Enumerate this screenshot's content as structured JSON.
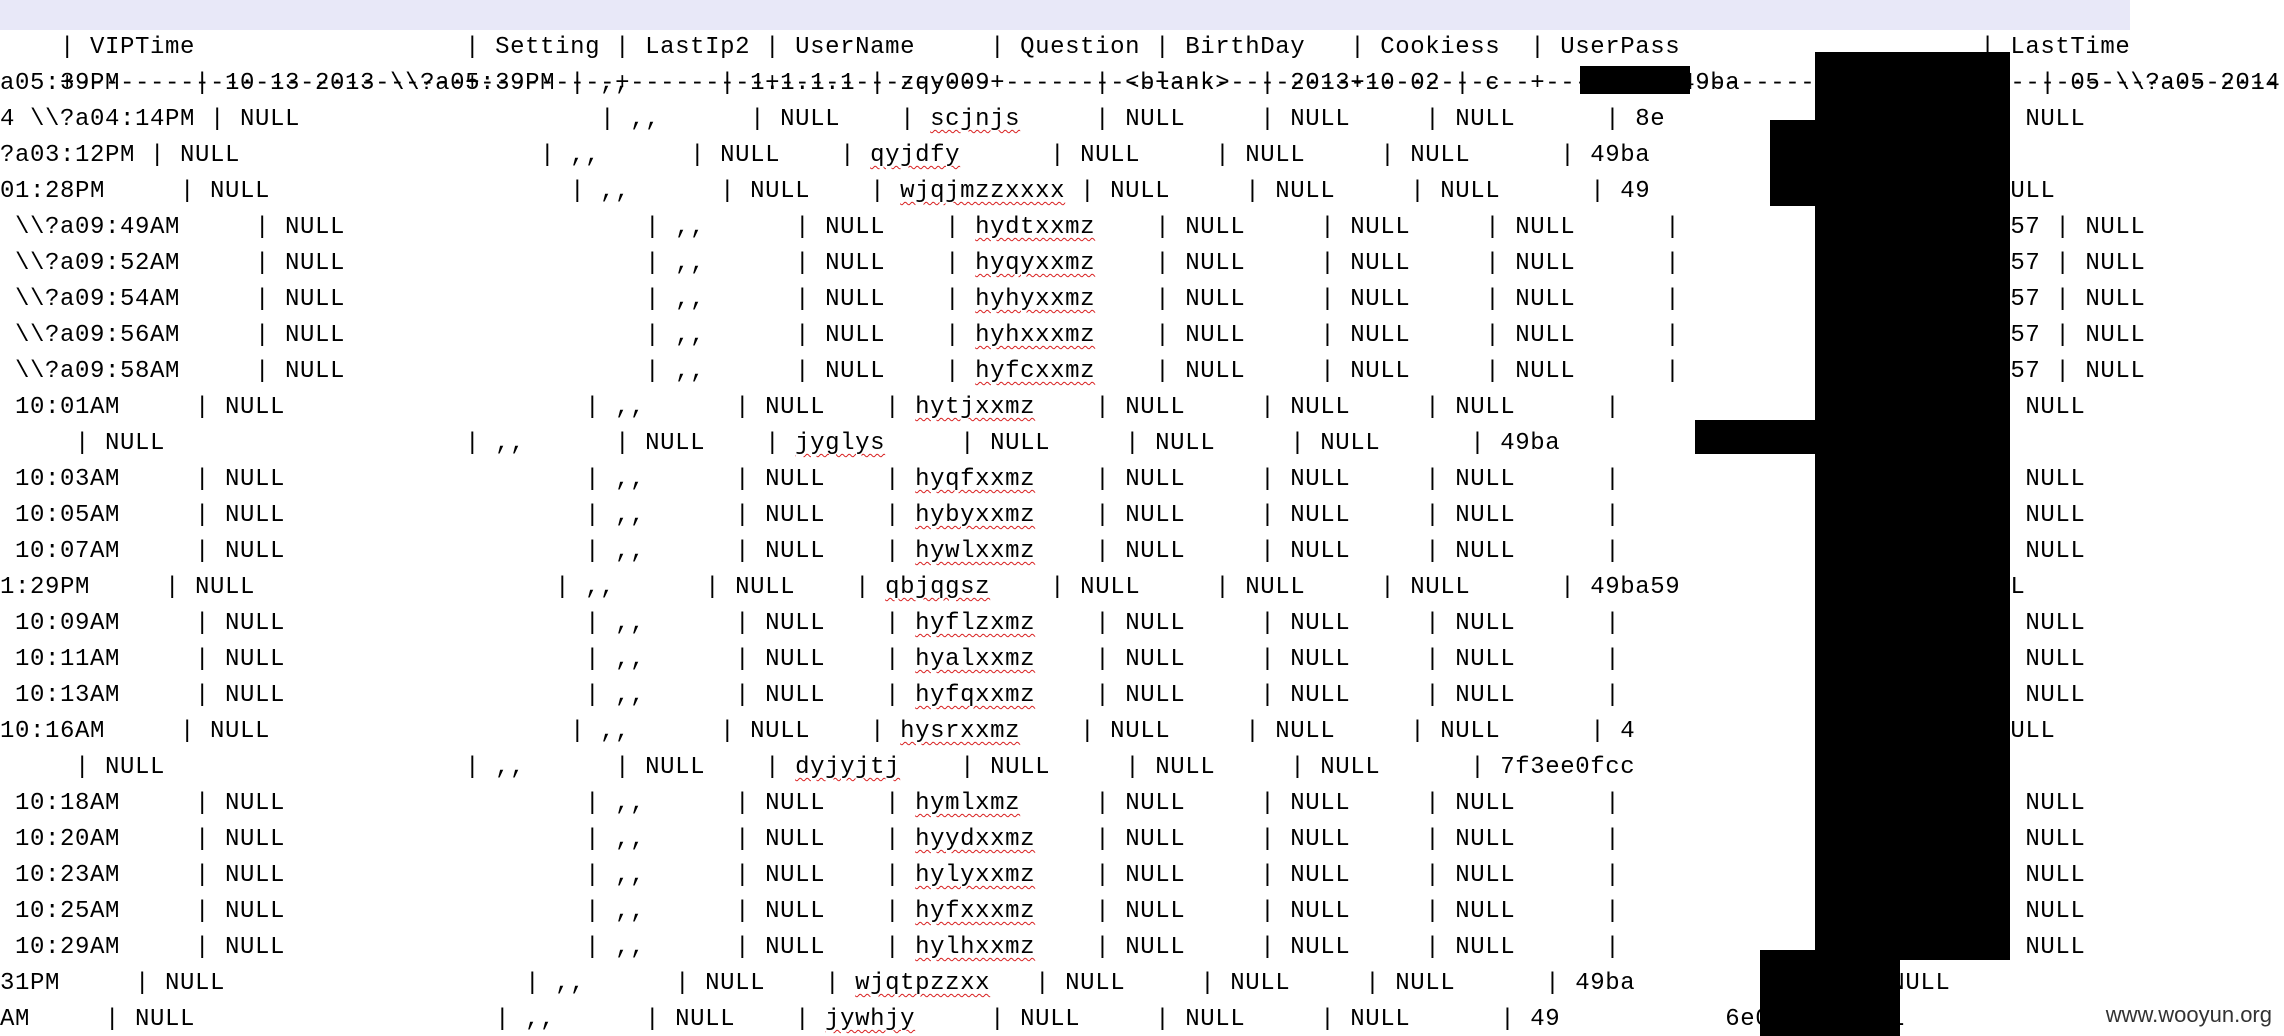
{
  "window": {
    "watermark": "www.wooyun.org"
  },
  "header": {
    "text": "| VIPTime                  | Setting | LastIp2 | UserName     | Question | BirthDay   | Cookiess  | UserPass                    | LastTime"
  },
  "separator": {
    "text": "+--------------------------+---------+---------+--------------+----------+------------+-----------+----------------------------+-----------------------------"
  },
  "rows": [
    {
      "text": "a05:39PM     | 10 13 2013 \\\\?a05:39PM | ,,      | 1.1.1.1 | zqy009       | <blank>  | 2013-10-02 | c        8 | 49ba                    | 05 \\\\?a05 2014"
    },
    {
      "text": "4 \\\\?a04:14PM | NULL                    | ,,      | NULL    | ",
      "wavy": "scjnjs",
      "tail": "     | NULL     | NULL     | NULL      | 8e                    b | NULL"
    },
    {
      "text": "?a03:12PM | NULL                    | ,,      | NULL    | ",
      "wavy": "qyjdfy",
      "tail": "      | NULL     | NULL     | NULL      | 49ba                    NULL"
    },
    {
      "text": "01:28PM     | NULL                    | ,,      | NULL    | ",
      "wavy": "wjqjmzzxxxx",
      "tail": " | NULL     | NULL     | NULL      | 49                     | NULL"
    },
    {
      "text": " \\\\?a09:49AM     | NULL                    | ,,      | NULL    | ",
      "wavy": "hydtxxmz",
      "tail": "    | NULL     | NULL     | NULL      |                    e057 | NULL"
    },
    {
      "text": " \\\\?a09:52AM     | NULL                    | ,,      | NULL    | ",
      "wavy": "hyqyxxmz",
      "tail": "    | NULL     | NULL     | NULL      |                    e057 | NULL"
    },
    {
      "text": " \\\\?a09:54AM     | NULL                    | ,,      | NULL    | ",
      "wavy": "hyhyxxmz",
      "tail": "    | NULL     | NULL     | NULL      |                    e057 | NULL"
    },
    {
      "text": " \\\\?a09:56AM     | NULL                    | ,,      | NULL    | ",
      "wavy": "hyhxxxmz",
      "tail": "    | NULL     | NULL     | NULL      |                    e057 | NULL"
    },
    {
      "text": " \\\\?a09:58AM     | NULL                    | ,,      | NULL    | ",
      "wavy": "hyfcxxmz",
      "tail": "    | NULL     | NULL     | NULL      |                    e057 | NULL"
    },
    {
      "text": " 10:01AM     | NULL                    | ,,      | NULL    | ",
      "wavy": "hytjxxmz",
      "tail": "    | NULL     | NULL     | NULL      |                    e057 | NULL"
    },
    {
      "text": "     | NULL                    | ,,      | NULL    | ",
      "wavy": "jyglys",
      "tail": "     | NULL     | NULL     | NULL      | 49ba"
    },
    {
      "text": " 10:03AM     | NULL                    | ,,      | NULL    | ",
      "wavy": "hyqfxxmz",
      "tail": "    | NULL     | NULL     | NULL      |                    e057 | NULL"
    },
    {
      "text": " 10:05AM     | NULL                    | ,,      | NULL    | ",
      "wavy": "hybyxxmz",
      "tail": "    | NULL     | NULL     | NULL      |                    e057 | NULL"
    },
    {
      "text": " 10:07AM     | NULL                    | ,,      | NULL    | ",
      "wavy": "hywlxxmz",
      "tail": "    | NULL     | NULL     | NULL      |                    e057 | NULL"
    },
    {
      "text": "1:29PM     | NULL                    | ,,      | NULL    | ",
      "wavy": "qbjqgsz",
      "tail": "    | NULL     | NULL     | NULL      | 49ba59                   NULL"
    },
    {
      "text": " 10:09AM     | NULL                    | ,,      | NULL    | ",
      "wavy": "hyflzxmz",
      "tail": "    | NULL     | NULL     | NULL      |                    e057 | NULL"
    },
    {
      "text": " 10:11AM     | NULL                    | ,,      | NULL    | ",
      "wavy": "hyalxxmz",
      "tail": "    | NULL     | NULL     | NULL      |                    e057 | NULL"
    },
    {
      "text": " 10:13AM     | NULL                    | ,,      | NULL    | ",
      "wavy": "hyfqxxmz",
      "tail": "    | NULL     | NULL     | NULL      |                    e057 | NULL"
    },
    {
      "text": "10:16AM     | NULL                    | ,,      | NULL    | ",
      "wavy": "hysrxxmz",
      "tail": "    | NULL     | NULL     | NULL      | 4                  057 | NULL"
    },
    {
      "text": "     | NULL                    | ,,      | NULL    | ",
      "wavy": "dyjyjtj",
      "tail": "    | NULL     | NULL     | NULL      | 7f3ee0fcc              LL"
    },
    {
      "text": " 10:18AM     | NULL                    | ,,      | NULL    | ",
      "wavy": "hymlxmz",
      "tail": "     | NULL     | NULL     | NULL      |                    e057 | NULL"
    },
    {
      "text": " 10:20AM     | NULL                    | ,,      | NULL    | ",
      "wavy": "hyydxxmz",
      "tail": "    | NULL     | NULL     | NULL      |                    e057 | NULL"
    },
    {
      "text": " 10:23AM     | NULL                    | ,,      | NULL    | ",
      "wavy": "hylyxxmz",
      "tail": "    | NULL     | NULL     | NULL      |                    e057 | NULL"
    },
    {
      "text": " 10:25AM     | NULL                    | ,,      | NULL    | ",
      "wavy": "hyfxxxmz",
      "tail": "    | NULL     | NULL     | NULL      |                    e057 | NULL"
    },
    {
      "text": " 10:29AM     | NULL                    | ,,      | NULL    | ",
      "wavy": "hylhxxmz",
      "tail": "    | NULL     | NULL     | NULL      |                    e057 | NULL"
    },
    {
      "text": "31PM     | NULL                    | ,,      | NULL    | ",
      "wavy": "wjqtpzzxx",
      "tail": "   | NULL     | NULL     | NULL      | 49ba          e057 | NULL"
    },
    {
      "text": "AM     | NULL                    | ,,      | NULL    | ",
      "wavy": "jywhjy",
      "tail": "     | NULL     | NULL     | NULL      | 49           6e057 | NULL"
    }
  ]
}
